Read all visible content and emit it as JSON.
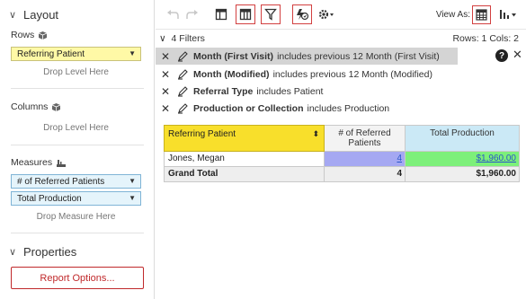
{
  "left_panel": {
    "layout_title": "Layout",
    "rows_label": "Rows",
    "rows_chip": "Referring Patient",
    "rows_drop": "Drop Level Here",
    "columns_label": "Columns",
    "columns_drop": "Drop Level Here",
    "measures_label": "Measures",
    "measure_chips": [
      "# of Referred Patients",
      "Total Production"
    ],
    "measures_drop": "Drop Measure Here",
    "properties_title": "Properties",
    "report_options_label": "Report Options..."
  },
  "toolbar": {
    "view_as_label": "View As:"
  },
  "filters": {
    "count_label": "4 Filters",
    "grid_size": "Rows: 1  Cols: 2",
    "items": [
      {
        "field": "Month (First Visit)",
        "condition": "includes previous 12 Month (First Visit)"
      },
      {
        "field": "Month (Modified)",
        "condition": "includes previous 12 Month (Modified)"
      },
      {
        "field": "Referral Type",
        "condition": "includes Patient"
      },
      {
        "field": "Production or Collection",
        "condition": "includes Production"
      }
    ]
  },
  "grid": {
    "col_header_rows": "Referring Patient",
    "col_header_referred": "# of Referred Patients",
    "col_header_production": "Total Production",
    "rows": [
      {
        "name": "Jones, Megan",
        "referred": "4",
        "production": "$1,960.00"
      }
    ],
    "grand_total_label": "Grand Total",
    "grand_total_referred": "4",
    "grand_total_production": "$1,960.00"
  },
  "colors": {
    "accent_red": "#c0292b",
    "header_yellow": "#f8df2b",
    "header_blue": "#cbe9f6",
    "cell_purple": "#a5a8f2",
    "cell_green": "#7df07a"
  }
}
